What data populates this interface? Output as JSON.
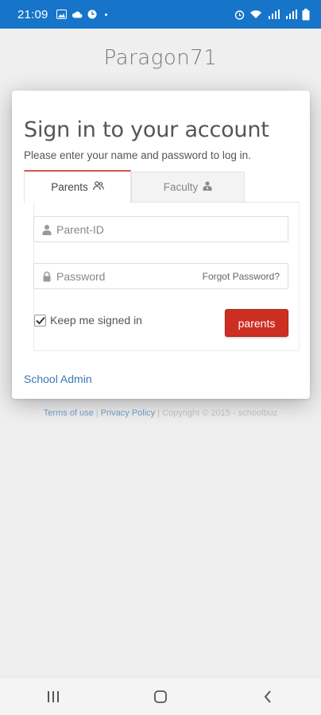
{
  "status_bar": {
    "time": "21:09",
    "left_icons": [
      "gallery-icon",
      "cloud-icon",
      "sync-icon"
    ],
    "right_icons": [
      "alarm-icon",
      "wifi-icon",
      "signal-icon-1",
      "signal-icon-2",
      "battery-icon"
    ]
  },
  "app": {
    "title": "Paragon71"
  },
  "card": {
    "heading": "Sign in to your account",
    "subheading": "Please enter your name and password to log in."
  },
  "tabs": [
    {
      "label": "Parents",
      "icon": "users-icon",
      "active": true
    },
    {
      "label": "Faculty",
      "icon": "user-tie-icon",
      "active": false
    }
  ],
  "form": {
    "parent_id_placeholder": "Parent-ID",
    "password_placeholder": "Password",
    "forgot_label": "Forgot Password?",
    "keep_signed_in_label": "Keep me signed in",
    "keep_signed_in_checked": true,
    "submit_label": "parents"
  },
  "links": {
    "school_admin": "School Admin"
  },
  "footer": {
    "terms": "Terms of use",
    "sep1": " | ",
    "privacy": "Privacy Policy",
    "sep2": " | ",
    "copyright": "Copyright © 2015 - schoolbuz"
  },
  "colors": {
    "status_bar": "#1675c9",
    "active_tab_border": "#d9534f",
    "primary_button": "#cc2f22",
    "link": "#3a78b8"
  }
}
